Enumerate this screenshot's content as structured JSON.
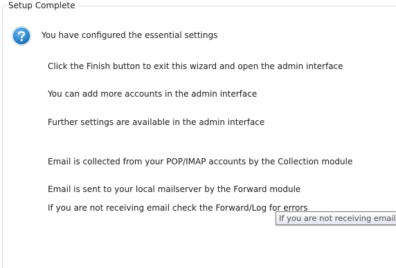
{
  "groupbox": {
    "title": "Setup Complete"
  },
  "icon": "question-icon",
  "colors": {
    "icon_fill": "#2f8ad0",
    "groupbox_border": "#d5dfe5",
    "tooltip_border": "#767676"
  },
  "messages": {
    "configured": "You have configured the essential settings",
    "finish": "Click the Finish button to exit this wizard and open the admin interface",
    "accounts": "You can add more accounts in the admin interface",
    "settings": "Further settings are available in the admin interface",
    "collection": "Email is collected from your POP/IMAP accounts by the Collection module",
    "forward": "Email is sent to your local mailserver by the Forward module",
    "errors": "If you are not receiving email check the Forward/Log for errors"
  },
  "tooltip": {
    "text": "If you are not receiving email check the Forward/Log for errors"
  }
}
